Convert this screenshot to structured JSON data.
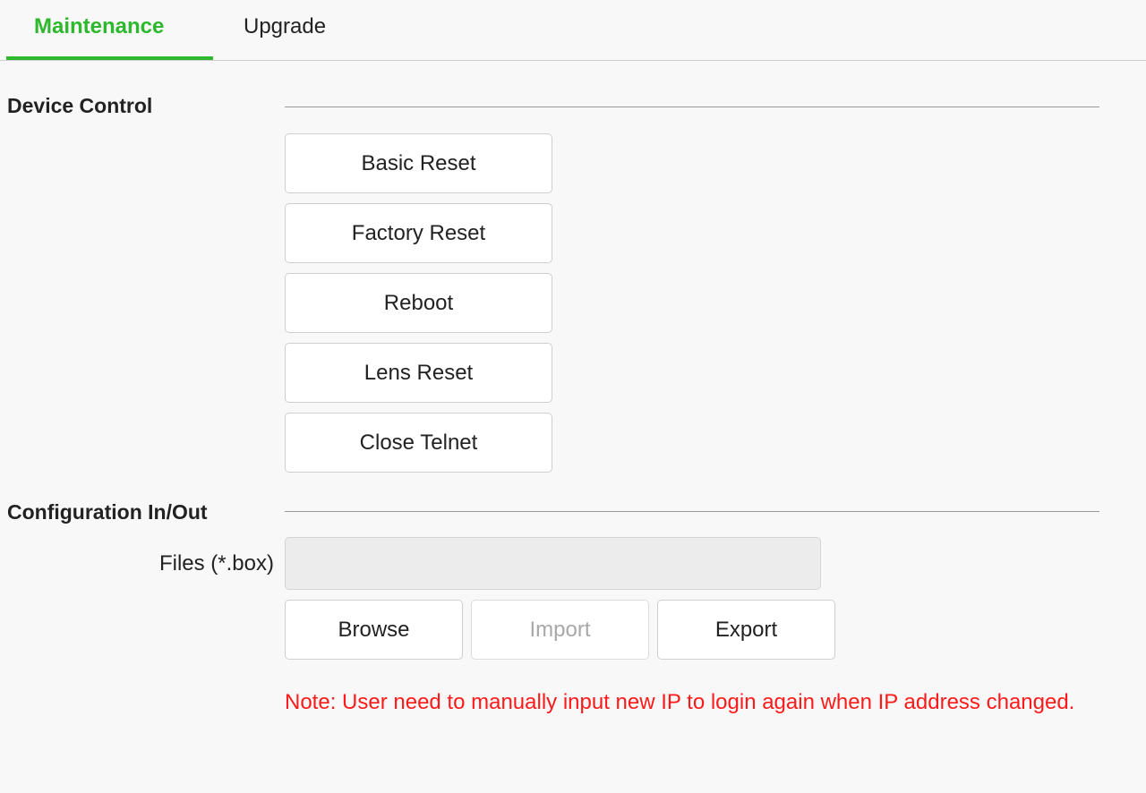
{
  "tabs": {
    "maintenance": "Maintenance",
    "upgrade": "Upgrade"
  },
  "device_control": {
    "title": "Device Control",
    "buttons": [
      "Basic Reset",
      "Factory Reset",
      "Reboot",
      "Lens Reset",
      "Close Telnet"
    ]
  },
  "config": {
    "title": "Configuration In/Out",
    "files_label": "Files (*.box)",
    "files_value": "",
    "browse": "Browse",
    "import": "Import",
    "export": "Export",
    "note": "Note: User need to manually input new IP to login again when IP address changed."
  },
  "colors": {
    "accent": "#2db82d",
    "note": "#ff1a1a"
  }
}
